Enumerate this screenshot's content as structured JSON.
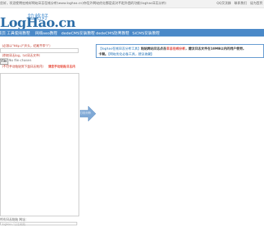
{
  "topbar": {
    "welcome": "您好，欢迎使用拉格好网站日志在线分析(www.loghao.cn)你在外网站优化都是说对不起外面的功能(loghao日志分析)",
    "links": [
      "QQ交流群",
      "联系我们",
      "设为首页"
    ]
  },
  "logo": {
    "tag": "拉格好",
    "main": "LogHao.cn"
  },
  "nav": {
    "items": [
      "首页",
      "工具使用教程",
      "网络seo教程",
      "dedeCMS安装教程",
      "dedeCMS防黑教程",
      "SiCMS安装教程"
    ]
  },
  "form": {
    "hint_url": "（必须以\"http://\"开头，结尾不带\"/\"）",
    "url_value": "",
    "hint_file": "（原始日志log、txt日志文件）",
    "file_button": "File",
    "file_status": "No file chosen",
    "hint_paste": "（不可手动粘贴到下面日志框内）",
    "hint_paste_warn": "请您手动粘贴日志内",
    "log_value": "",
    "footer_label": "所有日志粘贴 网址：",
    "footer_placeholder": "logHao / 日志粘贴"
  },
  "analyze": {
    "label": "日志分析"
  },
  "notice": {
    "prefix": "【loghao在线日志分析工具】",
    "text1": "粘贴网站日志点击",
    "highlight": "日志在线分析",
    "text2": "，建议日志文件在10MB以内的用户使用，",
    "line2_prefix": "卡顿。",
    "link": "【网站优化必备工具，建议收藏】"
  },
  "colors": {
    "nav_bg": "#4a89c8",
    "warn_red": "#d9342b",
    "link_blue": "#1f6fb5"
  }
}
